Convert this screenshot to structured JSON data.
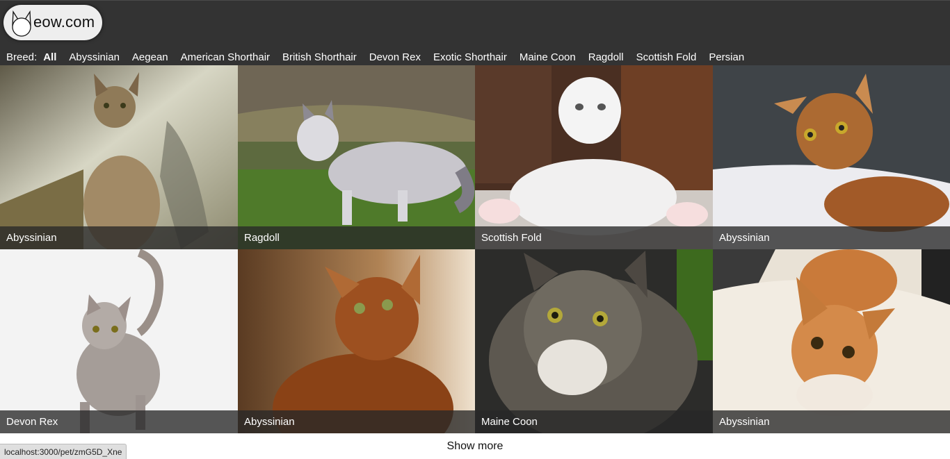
{
  "logo": {
    "text": "eow.com",
    "icon": "cat-head-icon"
  },
  "breed_filter": {
    "label": "Breed:",
    "items": [
      "All",
      "Abyssinian",
      "Aegean",
      "American Shorthair",
      "British Shorthair",
      "Devon Rex",
      "Exotic Shorthair",
      "Maine Coon",
      "Ragdoll",
      "Scottish Fold",
      "Persian"
    ],
    "selected": "All"
  },
  "pets": [
    {
      "breed": "Abyssinian"
    },
    {
      "breed": "Ragdoll"
    },
    {
      "breed": "Scottish Fold"
    },
    {
      "breed": "Abyssinian"
    },
    {
      "breed": "Devon Rex"
    },
    {
      "breed": "Abyssinian"
    },
    {
      "breed": "Maine Coon"
    },
    {
      "breed": "Abyssinian"
    }
  ],
  "show_more_label": "Show more",
  "status_bar_url": "localhost:3000/pet/zmG5D_Xne",
  "colors": {
    "header_bg": "#333333",
    "caption_bg": "#282828"
  }
}
